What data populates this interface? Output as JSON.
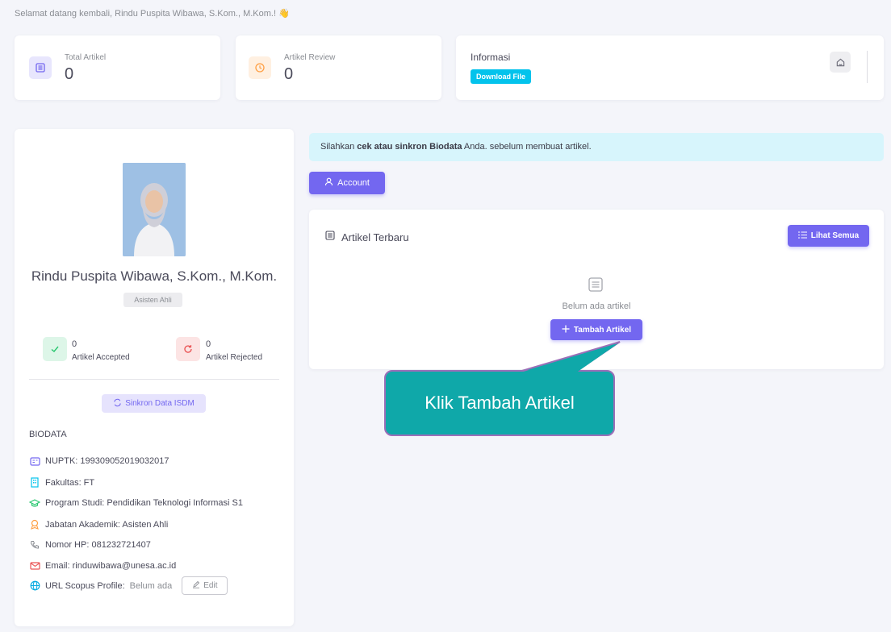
{
  "welcome": "Selamat datang kembali, Rindu Puspita Wibawa, S.Kom., M.Kom.! 👋",
  "stats": {
    "total": {
      "label": "Total Artikel",
      "value": "0"
    },
    "review": {
      "label": "Artikel Review",
      "value": "0"
    },
    "info": {
      "title": "Informasi",
      "button": "Download File"
    }
  },
  "alert": {
    "prefix": "Silahkan ",
    "strong": "cek atau sinkron Biodata",
    "suffix": " Anda. sebelum membuat artikel."
  },
  "account_button": "Account",
  "articles": {
    "title": "Artikel Terbaru",
    "see_all": "Lihat Semua",
    "empty": "Belum ada artikel",
    "add": "Tambah Artikel"
  },
  "profile": {
    "name": "Rindu Puspita Wibawa, S.Kom., M.Kom.",
    "rank": "Asisten Ahli",
    "accepted": {
      "value": "0",
      "label": "Artikel Accepted"
    },
    "rejected": {
      "value": "0",
      "label": "Artikel Rejected"
    },
    "sync_button": "Sinkron Data ISDM"
  },
  "biodata": {
    "title": "BIODATA",
    "nuptk": "NUPTK: 199309052019032017",
    "fakultas": "Fakultas: FT",
    "prodi": "Program Studi: Pendidikan Teknologi Informasi S1",
    "jabatan": "Jabatan Akademik: Asisten Ahli",
    "hp": "Nomor HP: 081232721407",
    "email": "Email: rinduwibawa@unesa.ac.id",
    "scopus_key": "URL Scopus Profile:",
    "scopus_value": "Belum ada",
    "edit": "Edit"
  },
  "callout": "Klik Tambah Artikel",
  "colors": {
    "primary": "#7367f0",
    "cyan": "#03c3ec",
    "callout": "#0fa8a9"
  }
}
